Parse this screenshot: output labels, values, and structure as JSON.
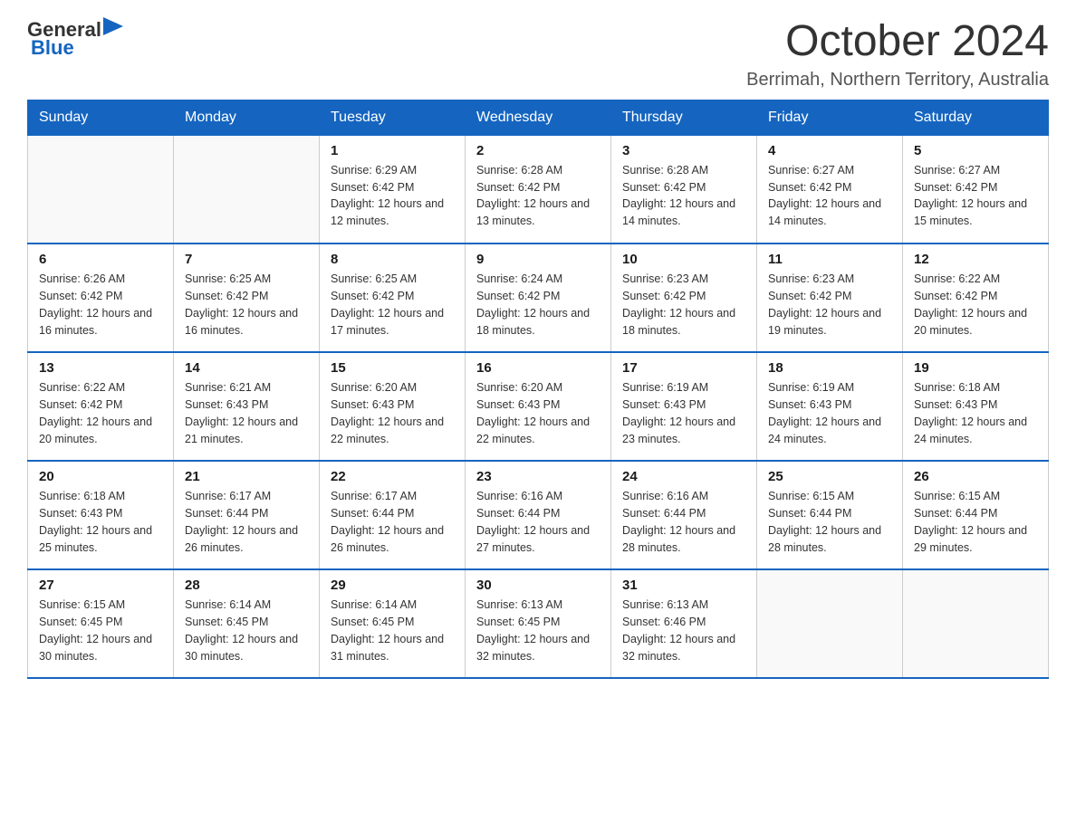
{
  "header": {
    "logo": {
      "general": "General",
      "blue": "Blue"
    },
    "title": "October 2024",
    "location": "Berrimah, Northern Territory, Australia"
  },
  "days_of_week": [
    "Sunday",
    "Monday",
    "Tuesday",
    "Wednesday",
    "Thursday",
    "Friday",
    "Saturday"
  ],
  "weeks": [
    [
      {
        "day": "",
        "sunrise": "",
        "sunset": "",
        "daylight": ""
      },
      {
        "day": "",
        "sunrise": "",
        "sunset": "",
        "daylight": ""
      },
      {
        "day": "1",
        "sunrise": "Sunrise: 6:29 AM",
        "sunset": "Sunset: 6:42 PM",
        "daylight": "Daylight: 12 hours and 12 minutes."
      },
      {
        "day": "2",
        "sunrise": "Sunrise: 6:28 AM",
        "sunset": "Sunset: 6:42 PM",
        "daylight": "Daylight: 12 hours and 13 minutes."
      },
      {
        "day": "3",
        "sunrise": "Sunrise: 6:28 AM",
        "sunset": "Sunset: 6:42 PM",
        "daylight": "Daylight: 12 hours and 14 minutes."
      },
      {
        "day": "4",
        "sunrise": "Sunrise: 6:27 AM",
        "sunset": "Sunset: 6:42 PM",
        "daylight": "Daylight: 12 hours and 14 minutes."
      },
      {
        "day": "5",
        "sunrise": "Sunrise: 6:27 AM",
        "sunset": "Sunset: 6:42 PM",
        "daylight": "Daylight: 12 hours and 15 minutes."
      }
    ],
    [
      {
        "day": "6",
        "sunrise": "Sunrise: 6:26 AM",
        "sunset": "Sunset: 6:42 PM",
        "daylight": "Daylight: 12 hours and 16 minutes."
      },
      {
        "day": "7",
        "sunrise": "Sunrise: 6:25 AM",
        "sunset": "Sunset: 6:42 PM",
        "daylight": "Daylight: 12 hours and 16 minutes."
      },
      {
        "day": "8",
        "sunrise": "Sunrise: 6:25 AM",
        "sunset": "Sunset: 6:42 PM",
        "daylight": "Daylight: 12 hours and 17 minutes."
      },
      {
        "day": "9",
        "sunrise": "Sunrise: 6:24 AM",
        "sunset": "Sunset: 6:42 PM",
        "daylight": "Daylight: 12 hours and 18 minutes."
      },
      {
        "day": "10",
        "sunrise": "Sunrise: 6:23 AM",
        "sunset": "Sunset: 6:42 PM",
        "daylight": "Daylight: 12 hours and 18 minutes."
      },
      {
        "day": "11",
        "sunrise": "Sunrise: 6:23 AM",
        "sunset": "Sunset: 6:42 PM",
        "daylight": "Daylight: 12 hours and 19 minutes."
      },
      {
        "day": "12",
        "sunrise": "Sunrise: 6:22 AM",
        "sunset": "Sunset: 6:42 PM",
        "daylight": "Daylight: 12 hours and 20 minutes."
      }
    ],
    [
      {
        "day": "13",
        "sunrise": "Sunrise: 6:22 AM",
        "sunset": "Sunset: 6:42 PM",
        "daylight": "Daylight: 12 hours and 20 minutes."
      },
      {
        "day": "14",
        "sunrise": "Sunrise: 6:21 AM",
        "sunset": "Sunset: 6:43 PM",
        "daylight": "Daylight: 12 hours and 21 minutes."
      },
      {
        "day": "15",
        "sunrise": "Sunrise: 6:20 AM",
        "sunset": "Sunset: 6:43 PM",
        "daylight": "Daylight: 12 hours and 22 minutes."
      },
      {
        "day": "16",
        "sunrise": "Sunrise: 6:20 AM",
        "sunset": "Sunset: 6:43 PM",
        "daylight": "Daylight: 12 hours and 22 minutes."
      },
      {
        "day": "17",
        "sunrise": "Sunrise: 6:19 AM",
        "sunset": "Sunset: 6:43 PM",
        "daylight": "Daylight: 12 hours and 23 minutes."
      },
      {
        "day": "18",
        "sunrise": "Sunrise: 6:19 AM",
        "sunset": "Sunset: 6:43 PM",
        "daylight": "Daylight: 12 hours and 24 minutes."
      },
      {
        "day": "19",
        "sunrise": "Sunrise: 6:18 AM",
        "sunset": "Sunset: 6:43 PM",
        "daylight": "Daylight: 12 hours and 24 minutes."
      }
    ],
    [
      {
        "day": "20",
        "sunrise": "Sunrise: 6:18 AM",
        "sunset": "Sunset: 6:43 PM",
        "daylight": "Daylight: 12 hours and 25 minutes."
      },
      {
        "day": "21",
        "sunrise": "Sunrise: 6:17 AM",
        "sunset": "Sunset: 6:44 PM",
        "daylight": "Daylight: 12 hours and 26 minutes."
      },
      {
        "day": "22",
        "sunrise": "Sunrise: 6:17 AM",
        "sunset": "Sunset: 6:44 PM",
        "daylight": "Daylight: 12 hours and 26 minutes."
      },
      {
        "day": "23",
        "sunrise": "Sunrise: 6:16 AM",
        "sunset": "Sunset: 6:44 PM",
        "daylight": "Daylight: 12 hours and 27 minutes."
      },
      {
        "day": "24",
        "sunrise": "Sunrise: 6:16 AM",
        "sunset": "Sunset: 6:44 PM",
        "daylight": "Daylight: 12 hours and 28 minutes."
      },
      {
        "day": "25",
        "sunrise": "Sunrise: 6:15 AM",
        "sunset": "Sunset: 6:44 PM",
        "daylight": "Daylight: 12 hours and 28 minutes."
      },
      {
        "day": "26",
        "sunrise": "Sunrise: 6:15 AM",
        "sunset": "Sunset: 6:44 PM",
        "daylight": "Daylight: 12 hours and 29 minutes."
      }
    ],
    [
      {
        "day": "27",
        "sunrise": "Sunrise: 6:15 AM",
        "sunset": "Sunset: 6:45 PM",
        "daylight": "Daylight: 12 hours and 30 minutes."
      },
      {
        "day": "28",
        "sunrise": "Sunrise: 6:14 AM",
        "sunset": "Sunset: 6:45 PM",
        "daylight": "Daylight: 12 hours and 30 minutes."
      },
      {
        "day": "29",
        "sunrise": "Sunrise: 6:14 AM",
        "sunset": "Sunset: 6:45 PM",
        "daylight": "Daylight: 12 hours and 31 minutes."
      },
      {
        "day": "30",
        "sunrise": "Sunrise: 6:13 AM",
        "sunset": "Sunset: 6:45 PM",
        "daylight": "Daylight: 12 hours and 32 minutes."
      },
      {
        "day": "31",
        "sunrise": "Sunrise: 6:13 AM",
        "sunset": "Sunset: 6:46 PM",
        "daylight": "Daylight: 12 hours and 32 minutes."
      },
      {
        "day": "",
        "sunrise": "",
        "sunset": "",
        "daylight": ""
      },
      {
        "day": "",
        "sunrise": "",
        "sunset": "",
        "daylight": ""
      }
    ]
  ]
}
